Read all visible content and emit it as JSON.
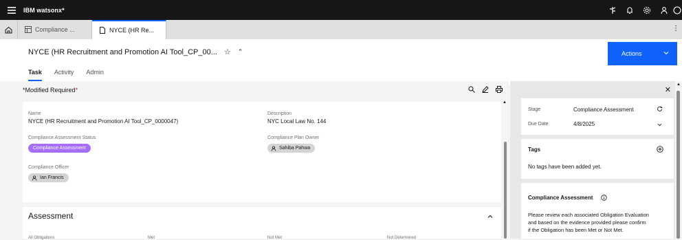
{
  "app": {
    "brand_ibm": "IBM",
    "brand_product": "watsonx*"
  },
  "tabs": [
    {
      "label": "Compliance ..."
    },
    {
      "label": "NYCE (HR Re..."
    }
  ],
  "record": {
    "title": "NYCE (HR Recruitment and Promotion AI Tool_CP_00...",
    "actions_label": "Actions"
  },
  "subtabs": [
    "Task",
    "Activity",
    "Admin"
  ],
  "form": {
    "modified_label": "*Modified",
    "required_label": "Required",
    "required_star": "*",
    "name_label": "Name",
    "name_value": "NYCE (HR Recruitment and Promotion AI Tool_CP_0000047)",
    "description_label": "Description",
    "description_value": "NYC Local Law No. 144",
    "status_label": "Compliance Assessment Status",
    "status_value": "Compliance Assessment",
    "owner_label": "Compliance Plan Owner",
    "owner_value": "Sahiba Pahwa",
    "officer_label": "Compliance Officer",
    "officer_value": "Ian Francis"
  },
  "assessment": {
    "title": "Assessment",
    "columns": [
      "All Obligations",
      "Met",
      "Not Met",
      "Not Determined"
    ]
  },
  "side": {
    "stage_label": "Stage",
    "stage_value": "Compliance Assessment",
    "due_label": "Due Date",
    "due_value": "4/8/2025",
    "tags_title": "Tags",
    "tags_empty": "No tags have been added yet.",
    "ca_title": "Compliance Assessment",
    "ca_text_1": "Please review each associated Obligation Evaluation",
    "ca_text_2": "and based on the evidence provided please confirm",
    "ca_text_3": "if the Obligation has been Met or Not Met."
  },
  "colors": {
    "accent": "#0f62fe",
    "status_pill": "#a56eff",
    "topbar": "#161616"
  }
}
